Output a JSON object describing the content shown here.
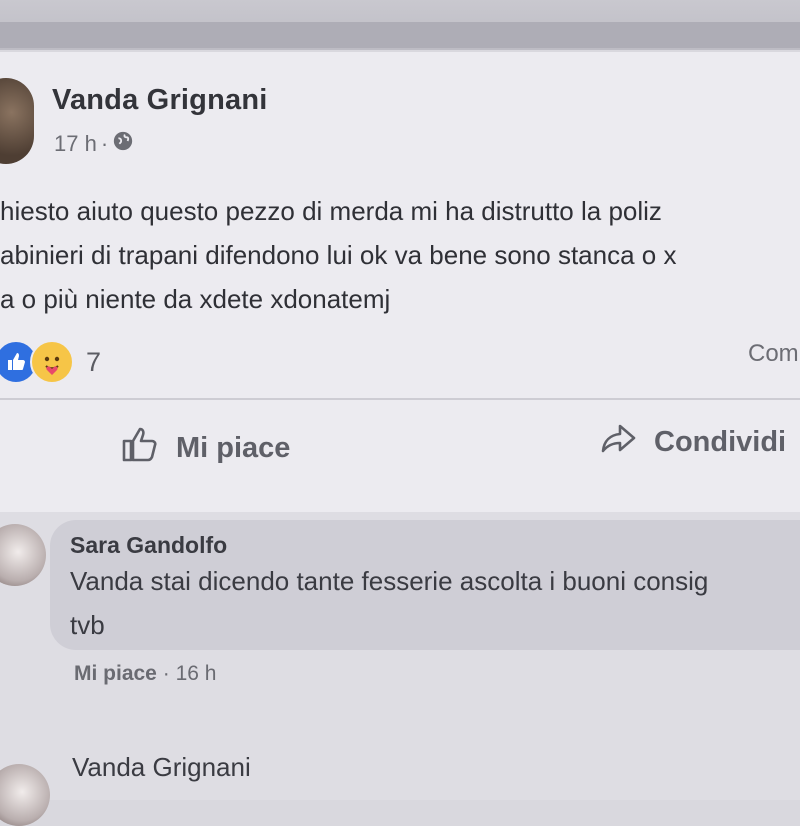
{
  "post": {
    "author": "Vanda Grignani",
    "time": "17 h",
    "separator": "·",
    "privacy_icon": "globe-icon",
    "lines": [
      "hiesto aiuto questo pezzo di merda mi ha distrutto la poliz",
      "abinieri di trapani difendono lui ok va bene sono stanca o x",
      "a o più niente da xdete xdonatemj"
    ],
    "reactions": {
      "icons": [
        "like-reaction-icon",
        "care-reaction-icon"
      ],
      "count": "7",
      "comments_label": "Com"
    },
    "actions": {
      "like_label": "Mi piace",
      "share_label": "Condividi"
    }
  },
  "comments": [
    {
      "author": "Sara Gandolfo",
      "lines": [
        "Vanda stai dicendo tante fesserie ascolta i buoni consig",
        "tvb"
      ],
      "like_label": "Mi piace",
      "separator": "·",
      "time": "16 h"
    },
    {
      "author": "Vanda Grignani"
    }
  ],
  "colors": {
    "like_blue": "#2f6fe0",
    "care_yellow": "#f6c547",
    "card_bg": "#ecebf0"
  }
}
